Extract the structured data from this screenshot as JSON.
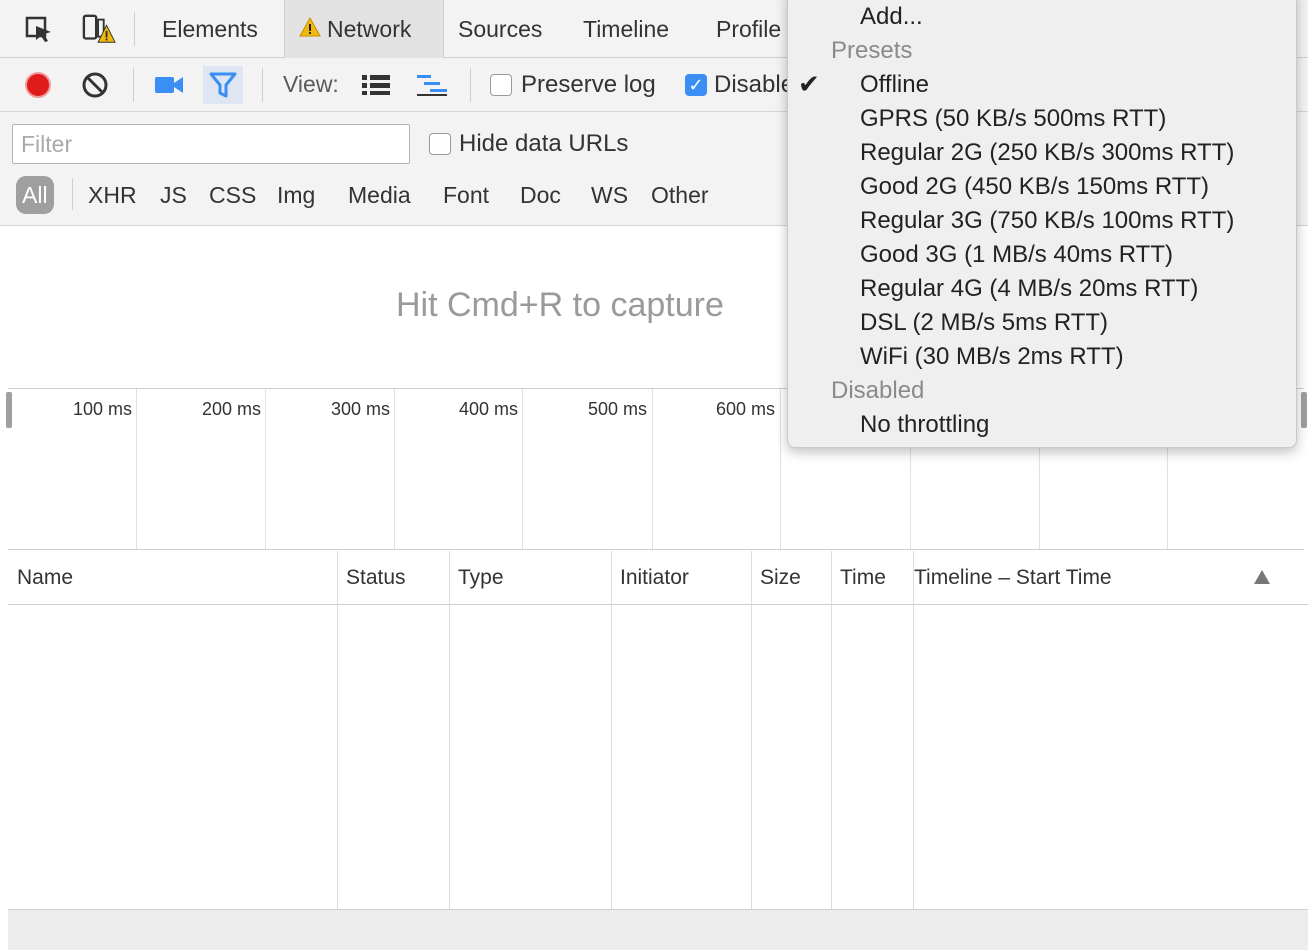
{
  "tabs": {
    "elements": "Elements",
    "network": "Network",
    "sources": "Sources",
    "timeline": "Timeline",
    "profiles": "Profile"
  },
  "toolbar": {
    "view_label": "View:",
    "preserve_log": "Preserve log",
    "disable_cache": "Disable"
  },
  "filter": {
    "placeholder": "Filter",
    "hide_data_urls": "Hide data URLs",
    "types": [
      "All",
      "XHR",
      "JS",
      "CSS",
      "Img",
      "Media",
      "Font",
      "Doc",
      "WS",
      "Other"
    ]
  },
  "empty_message": "Hit Cmd+R to capture",
  "overview": {
    "ticks": [
      "100 ms",
      "200 ms",
      "300 ms",
      "400 ms",
      "500 ms",
      "600 ms"
    ]
  },
  "grid": {
    "columns": [
      "Name",
      "Status",
      "Type",
      "Initiator",
      "Size",
      "Time",
      "Timeline – Start Time"
    ]
  },
  "throttle_menu": {
    "add": "Add...",
    "presets_header": "Presets",
    "presets": [
      "Offline",
      "GPRS (50 KB/s 500ms RTT)",
      "Regular 2G (250 KB/s 300ms RTT)",
      "Good 2G (450 KB/s 150ms RTT)",
      "Regular 3G (750 KB/s 100ms RTT)",
      "Good 3G (1 MB/s 40ms RTT)",
      "Regular 4G (4 MB/s 20ms RTT)",
      "DSL (2 MB/s 5ms RTT)",
      "WiFi (30 MB/s 2ms RTT)"
    ],
    "selected": "Offline",
    "disabled_header": "Disabled",
    "no_throttling": "No throttling"
  },
  "colors": {
    "record": "#e01b1b",
    "accent": "#3b8ef3",
    "warning": "#f2b80e"
  }
}
